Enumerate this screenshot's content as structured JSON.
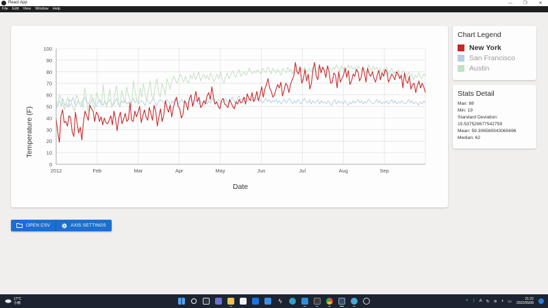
{
  "window": {
    "title": "React App",
    "menu": [
      "File",
      "Edit",
      "View",
      "Window",
      "Help"
    ],
    "controls": [
      "—",
      "❐",
      "✕"
    ]
  },
  "colors": {
    "new_york": "#c6282b",
    "san_francisco": "#b8cfe4",
    "austin": "#c4e0c2",
    "button": "#1c6fd1"
  },
  "legend": {
    "title": "Chart Legend",
    "items": [
      "New York",
      "San Francisco",
      "Austin"
    ],
    "active": "New York"
  },
  "stats": {
    "title": "Stats Detail",
    "lines": [
      "Max: 88",
      "Min: 19",
      "Standard Deviation:",
      "15.537529677542759",
      "Mean: 59.306569343065696",
      "Median: 62"
    ]
  },
  "buttons": {
    "open_csv": "OPEN CSV",
    "axis_settings": "AXIS SETTINGS"
  },
  "taskbar": {
    "weather_temp": "17°C",
    "weather_desc": "小雨",
    "time": "21:22",
    "date": "2022/05/08",
    "ime": "A",
    "apps": [
      "windows-start",
      "search",
      "task-view",
      "chat",
      "file-explorer",
      "store",
      "dropbox",
      "mail",
      "bolt",
      "edge",
      "vscode",
      "terminal",
      "chrome",
      "electron-app",
      "browser",
      "settings"
    ]
  },
  "chart_data": {
    "type": "line",
    "title": "",
    "xlabel": "Date",
    "ylabel": "Temperature (F)",
    "ylim": [
      0,
      100
    ],
    "yticks": [
      0,
      10,
      20,
      30,
      40,
      50,
      60,
      70,
      80,
      90,
      100
    ],
    "xticks": [
      "2012",
      "Feb",
      "Mar",
      "Apr",
      "May",
      "Jun",
      "Jul",
      "Aug",
      "Sep"
    ],
    "grid": true,
    "series": [
      {
        "name": "New York",
        "values": [
          39,
          28,
          19,
          42,
          47,
          36,
          37,
          33,
          42,
          40,
          28,
          24,
          45,
          36,
          27,
          32,
          21,
          37,
          46,
          42,
          38,
          51,
          48,
          46,
          37,
          45,
          43,
          37,
          41,
          34,
          40,
          36,
          35,
          38,
          42,
          34,
          46,
          39,
          29,
          40,
          45,
          35,
          39,
          44,
          37,
          39,
          53,
          38,
          37,
          46,
          41,
          45,
          50,
          36,
          42,
          47,
          41,
          38,
          49,
          44,
          38,
          51,
          46,
          33,
          41,
          48,
          37,
          42,
          55,
          49,
          45,
          51,
          41,
          49,
          54,
          58,
          50,
          48,
          40,
          43,
          55,
          52,
          47,
          57,
          60,
          50,
          56,
          63,
          54,
          58,
          49,
          51,
          55,
          52,
          59,
          62,
          56,
          67,
          58,
          52,
          54,
          50,
          48,
          55,
          57,
          52,
          51,
          49,
          56,
          53,
          50,
          48,
          54,
          52,
          56,
          53,
          54,
          58,
          52,
          61,
          57,
          55,
          62,
          54,
          57,
          63,
          55,
          60,
          67,
          58,
          65,
          69,
          74,
          66,
          63,
          58,
          60,
          65,
          69,
          66,
          71,
          59,
          64,
          70,
          68,
          62,
          69,
          73,
          76,
          88,
          80,
          78,
          84,
          70,
          74,
          82,
          72,
          78,
          65,
          70,
          82,
          88,
          76,
          73,
          86,
          79,
          84,
          81,
          75,
          85,
          80,
          70,
          71,
          79,
          77,
          66,
          80,
          71,
          74,
          77,
          83,
          75,
          81,
          69,
          72,
          78,
          76,
          82,
          80,
          72,
          75,
          84,
          79,
          71,
          83,
          78,
          76,
          80,
          74,
          71,
          77,
          81,
          73,
          79,
          76,
          82,
          80,
          71,
          74,
          78,
          76,
          73,
          80,
          78,
          74,
          77,
          66,
          79,
          72,
          70,
          76,
          65,
          69,
          70,
          62,
          68,
          72,
          66,
          70,
          67,
          62
        ]
      },
      {
        "name": "San Francisco",
        "values": [
          48,
          52,
          55,
          50,
          57,
          51,
          53,
          49,
          56,
          54,
          58,
          53,
          51,
          55,
          52,
          50,
          56,
          58,
          54,
          53,
          51,
          55,
          57,
          52,
          50,
          54,
          56,
          53,
          51,
          55,
          52,
          54,
          56,
          53,
          51,
          54,
          57,
          52,
          50,
          55,
          53,
          56,
          52,
          54,
          51,
          55,
          57,
          53,
          56,
          52,
          54,
          55,
          53,
          51,
          56,
          54,
          52,
          55,
          57,
          53,
          51,
          54,
          56,
          55,
          53,
          52,
          56,
          54,
          51,
          55,
          53,
          57,
          54,
          52,
          55,
          56,
          53,
          54,
          52,
          55,
          57,
          53,
          51,
          56,
          54,
          52,
          55,
          53,
          54,
          56,
          52,
          55,
          53,
          57,
          54,
          52,
          55,
          56,
          54,
          53,
          55,
          57,
          54,
          52,
          56,
          58,
          55,
          53,
          57,
          59,
          55,
          57,
          58,
          56,
          54,
          57,
          55,
          56,
          58,
          55,
          57,
          54,
          56,
          53,
          55,
          57,
          54,
          56,
          53,
          55,
          54,
          56,
          53,
          55,
          52,
          54,
          56,
          53,
          55,
          57,
          54,
          52,
          55,
          53,
          56,
          54,
          52,
          55,
          57,
          54,
          53,
          56,
          52,
          55,
          53,
          54,
          56,
          52,
          55,
          53,
          54,
          52,
          55,
          53,
          51,
          54,
          56,
          52,
          55,
          53,
          54,
          52,
          55,
          53,
          51,
          54,
          52,
          55,
          53,
          54,
          56,
          53,
          55,
          52,
          54,
          53,
          56,
          55,
          53,
          52,
          54,
          56,
          53,
          55,
          52,
          54,
          53,
          55,
          52,
          54,
          56,
          53,
          55,
          52,
          54,
          53,
          55,
          53,
          52,
          54,
          56,
          53,
          55,
          52,
          54,
          53,
          51,
          54,
          52,
          55,
          53
        ]
      },
      {
        "name": "Austin",
        "values": [
          55,
          50,
          60,
          56,
          52,
          47,
          54,
          58,
          50,
          53,
          49,
          46,
          60,
          57,
          52,
          54,
          49,
          66,
          58,
          45,
          56,
          60,
          52,
          47,
          62,
          58,
          54,
          51,
          69,
          55,
          49,
          57,
          65,
          49,
          52,
          61,
          68,
          55,
          49,
          64,
          58,
          53,
          67,
          60,
          55,
          49,
          72,
          63,
          56,
          52,
          66,
          58,
          70,
          61,
          55,
          64,
          72,
          59,
          56,
          68,
          74,
          63,
          58,
          70,
          66,
          60,
          74,
          69,
          65,
          72,
          76,
          73,
          70,
          74,
          78,
          75,
          71,
          76,
          72,
          70,
          77,
          74,
          79,
          73,
          76,
          80,
          72,
          75,
          78,
          74,
          77,
          73,
          79,
          76,
          71,
          75,
          78,
          74,
          80,
          73,
          70,
          76,
          79,
          74,
          77,
          81,
          78,
          75,
          79,
          82,
          76,
          78,
          80,
          77,
          79,
          83,
          80,
          78,
          81,
          79,
          82,
          80,
          78,
          83,
          81,
          79,
          84,
          82,
          78,
          83,
          81,
          79,
          82,
          80,
          77,
          83,
          81,
          79,
          84,
          80,
          82,
          78,
          83,
          81,
          79,
          85,
          82,
          80,
          84,
          79,
          81,
          83,
          80,
          84,
          82,
          79,
          83,
          85,
          81,
          84,
          82,
          80,
          85,
          83,
          81,
          84,
          82,
          86,
          83,
          80,
          85,
          82,
          84,
          81,
          86,
          83,
          85,
          82,
          84,
          80,
          85,
          83,
          81,
          84,
          82,
          79,
          86,
          83,
          81,
          85,
          82,
          84,
          80,
          83,
          78,
          82,
          79,
          84,
          77,
          81,
          83,
          78,
          80,
          76,
          82,
          74,
          79,
          81,
          77,
          75,
          80,
          76,
          78,
          73,
          77,
          75,
          79,
          76,
          74,
          78,
          76
        ]
      }
    ]
  }
}
